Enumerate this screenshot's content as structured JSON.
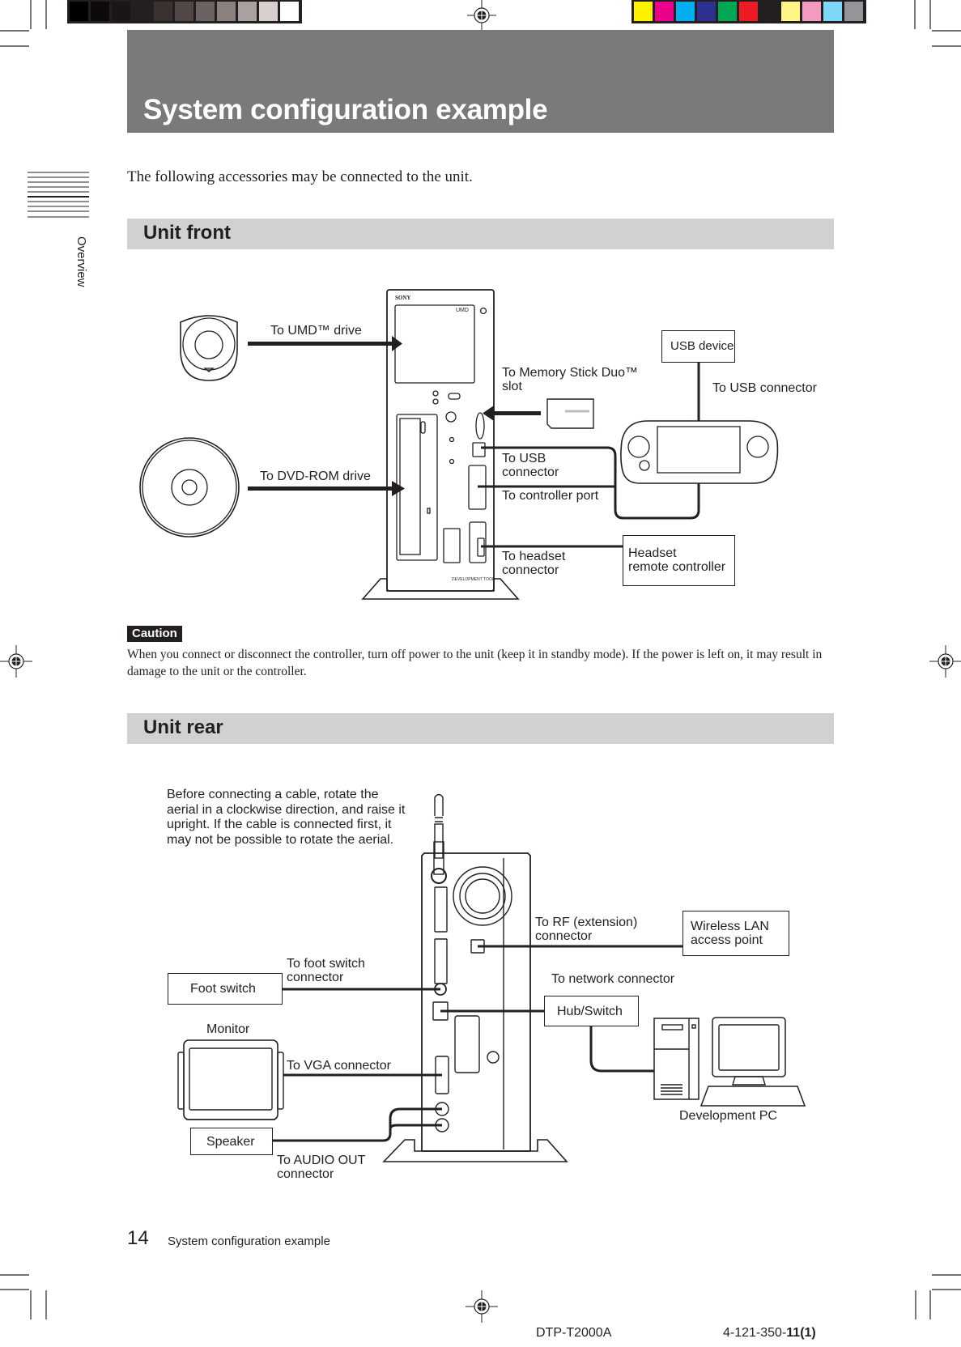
{
  "header": {
    "title": "System configuration example"
  },
  "side_tab": {
    "label": "Overview"
  },
  "intro": "The following accessories may be connected to the unit.",
  "sections": {
    "front": {
      "title": "Unit front",
      "labels": {
        "umd": "To UMD™ drive",
        "dvd": "To DVD-ROM drive",
        "memory_stick_l1": "To Memory Stick Duo™",
        "memory_stick_l2": "slot",
        "usb_conn_l1": "To USB",
        "usb_conn_l2": "connector",
        "controller_port": "To controller port",
        "headset_l1": "To headset",
        "headset_l2": "connector",
        "usb_connector_right": "To USB connector"
      },
      "boxes": {
        "usb_device": "USB device",
        "headset_remote_l1": "Headset",
        "headset_remote_l2": "remote controller"
      },
      "unit_text": {
        "brand": "SONY",
        "umd_logo": "UMD",
        "dev_tool": "DEVELOPMENT TOOL"
      }
    },
    "caution": {
      "badge": "Caution",
      "text": "When you connect or disconnect the controller, turn off power to the unit (keep it in standby mode). If the power is left on, it may result in damage to the unit or the controller."
    },
    "rear": {
      "title": "Unit rear",
      "note": [
        "Before connecting a cable, rotate the",
        "aerial in a clockwise direction, and raise it",
        "upright. If the cable is connected first, it",
        "may not be possible to rotate the aerial."
      ],
      "labels": {
        "rf_l1": "To RF (extension)",
        "rf_l2": "connector",
        "foot_l1": "To foot switch",
        "foot_l2": "connector",
        "network": "To network connector",
        "monitor": "Monitor",
        "vga": "To VGA connector",
        "audio_l1": "To AUDIO OUT",
        "audio_l2": "connector",
        "dev_pc": "Development PC"
      },
      "boxes": {
        "wlan_l1": "Wireless LAN",
        "wlan_l2": "access point",
        "foot_switch": "Foot switch",
        "hub": "Hub/Switch",
        "speaker": "Speaker"
      }
    }
  },
  "footer": {
    "page_number": "14",
    "section": "System configuration example"
  },
  "imprint": {
    "model": "DTP-T2000A",
    "code_prefix": "4-121-350-",
    "code_suffix": "11(1)"
  },
  "color_bars": {
    "gray": [
      "#000000",
      "#0c0a0a",
      "#1a1616",
      "#231f1e",
      "#3a3231",
      "#514747",
      "#6b6262",
      "#8a807e",
      "#a9a19f",
      "#d7cfce",
      "#ffffff"
    ],
    "color": [
      "#fff200",
      "#ec008c",
      "#00aeef",
      "#2e3192",
      "#00a651",
      "#ed1c24",
      "#231f20",
      "#fff685",
      "#f49ac1",
      "#7dd8f8",
      "#939598"
    ]
  }
}
